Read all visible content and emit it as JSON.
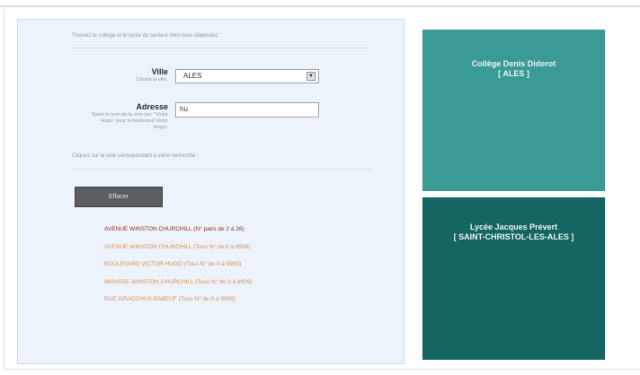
{
  "intro_text": "Trouvez le collège et le lycée du secteur dont vous dépendez :",
  "ville": {
    "label": "Ville",
    "sub_label": "Choisir la ville.",
    "selected": "ALES"
  },
  "adresse": {
    "label": "Adresse",
    "sub_label": "Saisir le nom de la voie (ex: \"Victor Hugo\" pour le boulevard Victor Hugo).",
    "value": "hu"
  },
  "hint_text": "Cliquez sur la voie correspondant à votre recherche :",
  "clear_button": "Effacer",
  "results": [
    "AVENUE WINSTON CHURCHILL (N° pairs de 2 à 26)",
    "AVENUE WINSTON CHURCHILL (Tous N° de 0 à 9999)",
    "BOULEVARD VICTOR HUGO (Tous N° de 0 à 9999)",
    "IMPASSE WINSTON CHURCHILL (Tous N° de 0 à 9999)",
    "RUE GRACCHUS-BABEUF (Tous N° de 0 à 9999)"
  ],
  "college": {
    "name": "Collège Denis Diderot",
    "city": "[ ALES ]"
  },
  "lycee": {
    "name": "Lycée Jacques Prévert",
    "city": "[ SAINT-CHRISTOL-LES-ALES ]"
  },
  "colors": {
    "panel_bg": "#ecf3fa",
    "college_bg": "#3a9a95",
    "lycee_bg": "#156663",
    "result_dark": "#8f3023",
    "result_light": "#d8904f"
  }
}
